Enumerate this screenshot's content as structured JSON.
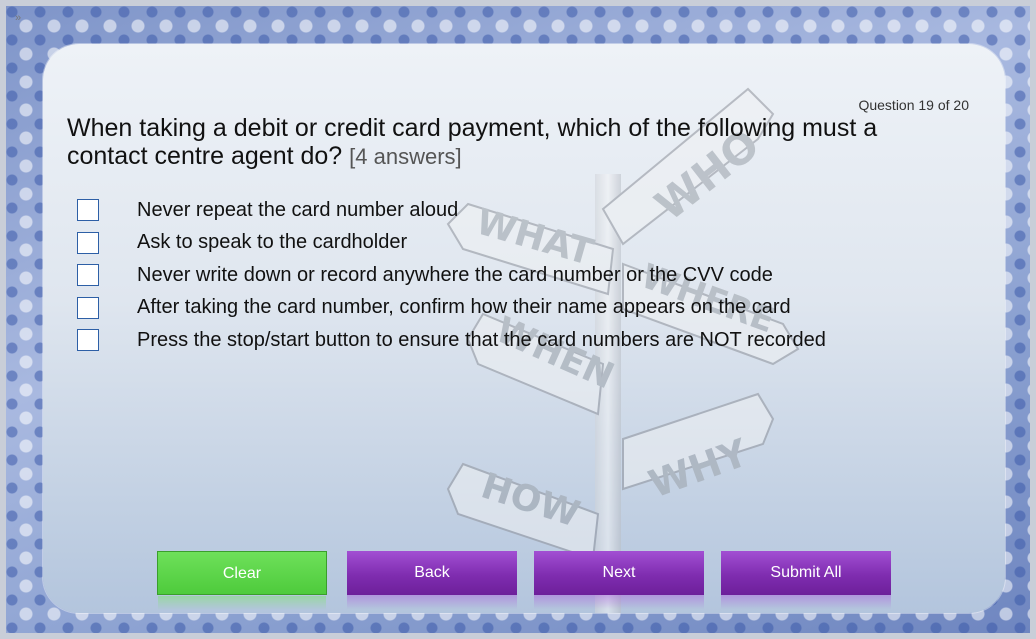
{
  "collapse_toggle": "»",
  "counter": "Question 19 of 20",
  "question": {
    "text": "When taking a debit or credit card payment, which of the following must a contact centre agent do?",
    "hint": "[4 answers]"
  },
  "answers": [
    "Never repeat the card number aloud",
    "Ask to speak to the cardholder",
    "Never write down or record anywhere the card number or the CVV code",
    "After taking the card number, confirm how their name appears on the card",
    "Press the stop/start button to ensure that the card numbers are NOT recorded"
  ],
  "background_image": {
    "signs": [
      "WHO",
      "WHAT",
      "WHERE",
      "WHEN",
      "WHY",
      "HOW"
    ]
  },
  "buttons": {
    "clear": "Clear",
    "back": "Back",
    "next": "Next",
    "submit": "Submit All"
  },
  "colors": {
    "clear_button": "#5fd44b",
    "nav_button": "#8a35bb",
    "checkbox_border": "#2d5fa6"
  }
}
